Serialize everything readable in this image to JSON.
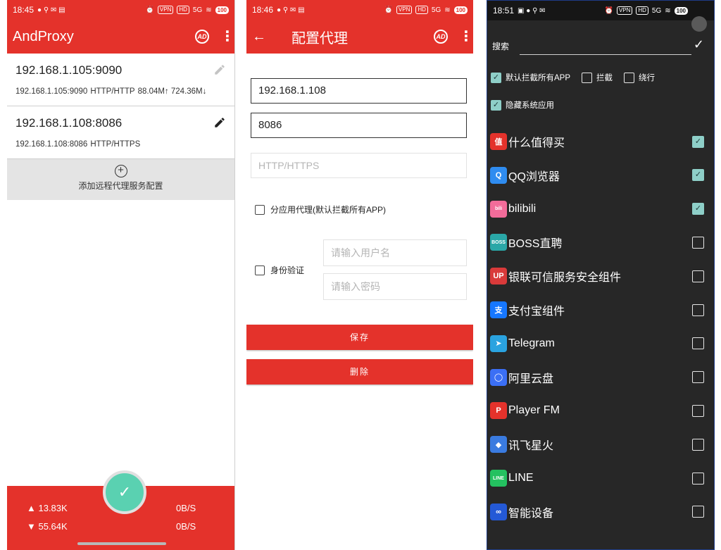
{
  "panel1": {
    "status": {
      "time": "18:45",
      "vpn": "VPN",
      "hd": "HD",
      "signal": "5G",
      "battery": "100"
    },
    "title": "AndProxy",
    "ad_label": "AD",
    "proxies": [
      {
        "host": "192.168.1.105:9090",
        "detail_host": "192.168.1.105:9090",
        "protocol": "HTTP/HTTP",
        "traffic": "88.04M↑ 724.36M↓"
      },
      {
        "host": "192.168.1.108:8086",
        "detail_host": "192.168.1.108:8086",
        "protocol": "HTTP/HTTPS",
        "traffic": ""
      }
    ],
    "add_label": "添加远程代理服务配置",
    "stats": {
      "up": "▲ 13.83K",
      "down": "▼ 55.64K",
      "up_rate": "0B/S",
      "down_rate": "0B/S"
    },
    "fab_icon": "✓"
  },
  "panel2": {
    "status": {
      "time": "18:46",
      "vpn": "VPN",
      "hd": "HD",
      "signal": "5G",
      "battery": "100"
    },
    "title": "配置代理",
    "ad_label": "AD",
    "host_value": "192.168.1.108",
    "port_value": "8086",
    "protocol_placeholder": "HTTP/HTTPS",
    "per_app_label": "分应用代理(默认拦截所有APP)",
    "auth_label": "身份验证",
    "username_placeholder": "请输入用户名",
    "password_placeholder": "请输入密码",
    "save_label": "保存",
    "delete_label": "删除"
  },
  "panel3": {
    "status": {
      "time": "18:51",
      "vpn": "VPN",
      "hd": "HD",
      "signal": "5G",
      "battery": "100"
    },
    "search_label": "搜索",
    "options": {
      "intercept_all": "默认拦截所有APP",
      "intercept": "拦截",
      "bypass": "绕行",
      "hide_system": "隐藏系统应用"
    },
    "apps": [
      {
        "name": "什么值得买",
        "icon": "值",
        "color": "#e4322b",
        "checked": true
      },
      {
        "name": "QQ浏览器",
        "icon": "Q",
        "color": "#2f8cf0",
        "checked": true
      },
      {
        "name": "bilibili",
        "icon": "bili",
        "color": "#f26c9a",
        "checked": true
      },
      {
        "name": "BOSS直聘",
        "icon": "BOSS",
        "color": "#2aa7a7",
        "checked": false
      },
      {
        "name": "银联可信服务安全组件",
        "icon": "UP",
        "color": "#d93a3a",
        "checked": false
      },
      {
        "name": "支付宝组件",
        "icon": "支",
        "color": "#1677ff",
        "checked": false
      },
      {
        "name": "Telegram",
        "icon": "➤",
        "color": "#2aa3e0",
        "checked": false
      },
      {
        "name": "阿里云盘",
        "icon": "◯",
        "color": "#3b6ff5",
        "checked": false
      },
      {
        "name": "Player FM",
        "icon": "P",
        "color": "#e4322b",
        "checked": false
      },
      {
        "name": "讯飞星火",
        "icon": "◆",
        "color": "#3a7be0",
        "checked": false
      },
      {
        "name": "LINE",
        "icon": "LINE",
        "color": "#24c160",
        "checked": false
      },
      {
        "name": "智能设备",
        "icon": "∞",
        "color": "#2459d6",
        "checked": false
      }
    ]
  }
}
